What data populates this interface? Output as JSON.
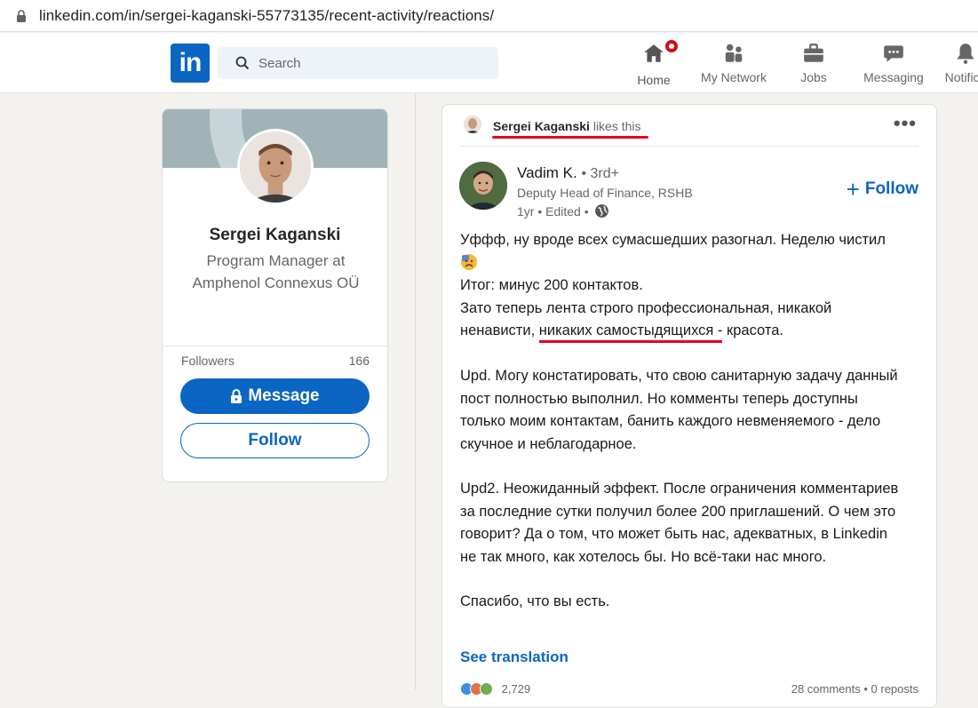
{
  "browser": {
    "url": "linkedin.com/in/sergei-kaganski-55773135/recent-activity/reactions/"
  },
  "nav": {
    "logo_text": "in",
    "search_placeholder": "Search",
    "items": [
      {
        "label": "Home",
        "icon": "home-icon"
      },
      {
        "label": "My Network",
        "icon": "network-icon"
      },
      {
        "label": "Jobs",
        "icon": "jobs-icon"
      },
      {
        "label": "Messaging",
        "icon": "messaging-icon"
      },
      {
        "label": "Notifica",
        "icon": "notifications-icon"
      }
    ]
  },
  "profile": {
    "name": "Sergei Kaganski",
    "headline": "Program Manager at Amphenol Connexus OÜ",
    "followers_label": "Followers",
    "followers_count": "166",
    "message_button": "Message",
    "follow_button": "Follow"
  },
  "post": {
    "activity_actor": "Sergei Kaganski",
    "activity_action": "likes this",
    "author_name": "Vadim K.",
    "author_degree": "• 3rd+",
    "author_title": "Deputy Head of Finance, RSHB",
    "meta_time": "1yr • Edited •",
    "follow_label": "Follow",
    "body": {
      "line1": "Уффф, ну вроде всех сумасшедших разогнал. Неделю чистил",
      "line2": "Итог: минус 200 контактов.",
      "line3": "Зато теперь лента строго профессиональная, никакой",
      "line4_pre": "ненависти,",
      "line4_highlight": "никаких самостыдящихся -",
      "line4_post": "красота.",
      "para2": "Upd. Могу констатировать, что свою санитарную задачу данный пост полностью выполнил. Но комменты теперь доступны только моим контактам, банить каждого невменяемого - дело скучное и неблагодарное.",
      "para3": "Upd2. Неожиданный эффект. После ограничения комментариев за последние сутки получил более 200 приглашений. О чем это говорит? Да о том, что может быть нас, адекватных, в Linkedin не так много, как хотелось бы. Но всё-таки нас много.",
      "para4": "Спасибо, что вы есть."
    },
    "see_translation": "See translation",
    "reactions_count": "2,729",
    "comments_reposts": "28 comments • 0 reposts"
  }
}
